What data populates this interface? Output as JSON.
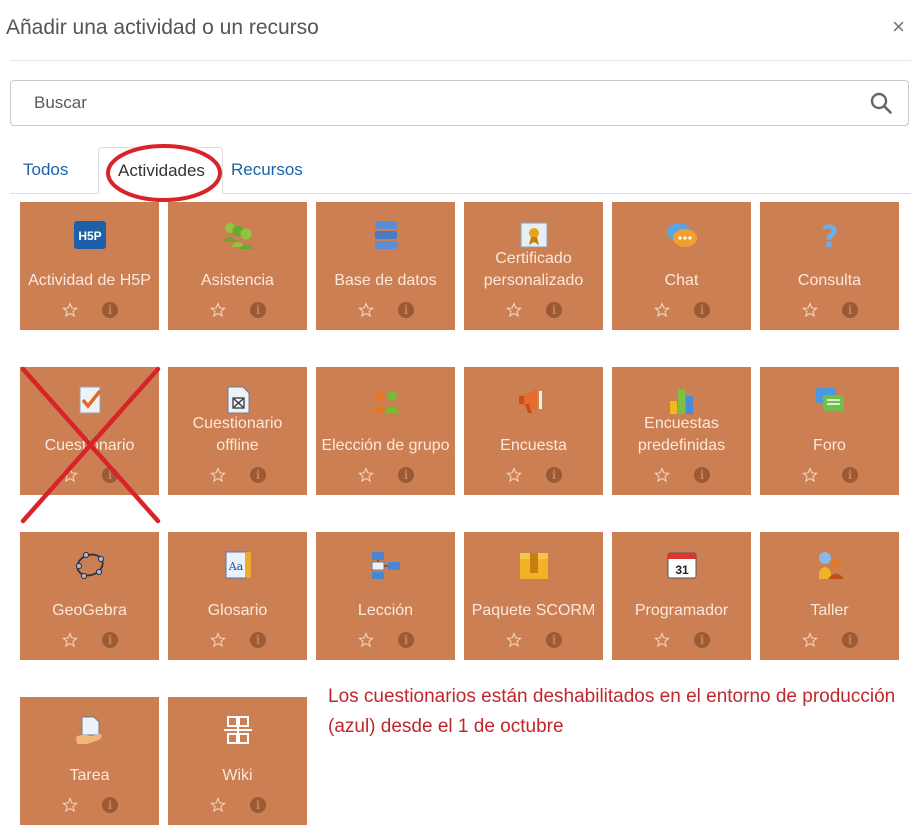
{
  "dialog": {
    "title": "Añadir una actividad o un recurso",
    "close_glyph": "×"
  },
  "search": {
    "placeholder": "Buscar",
    "value": "",
    "icon": "search-icon"
  },
  "tabs": [
    {
      "label": "Todos",
      "active": false
    },
    {
      "label": "Actividades",
      "active": true
    },
    {
      "label": "Recursos",
      "active": false
    }
  ],
  "items": [
    {
      "label": "Actividad de H5P",
      "icon": "h5p-icon"
    },
    {
      "label": "Asistencia",
      "icon": "attendance-icon"
    },
    {
      "label": "Base de datos",
      "icon": "database-icon"
    },
    {
      "label": "Certificado personalizado",
      "icon": "certificate-icon"
    },
    {
      "label": "Chat",
      "icon": "chat-icon"
    },
    {
      "label": "Consulta",
      "icon": "question-icon"
    },
    {
      "label": "Cuestionario",
      "icon": "quiz-icon"
    },
    {
      "label": "Cuestionario offline",
      "icon": "offline-quiz-icon"
    },
    {
      "label": "Elección de grupo",
      "icon": "group-choice-icon"
    },
    {
      "label": "Encuesta",
      "icon": "megaphone-icon"
    },
    {
      "label": "Encuestas predefinidas",
      "icon": "bar-chart-icon"
    },
    {
      "label": "Foro",
      "icon": "forum-icon"
    },
    {
      "label": "GeoGebra",
      "icon": "geogebra-icon"
    },
    {
      "label": "Glosario",
      "icon": "glossary-icon"
    },
    {
      "label": "Lección",
      "icon": "lesson-icon"
    },
    {
      "label": "Paquete SCORM",
      "icon": "package-icon"
    },
    {
      "label": "Programador",
      "icon": "calendar-icon"
    },
    {
      "label": "Taller",
      "icon": "workshop-icon"
    },
    {
      "label": "Tarea",
      "icon": "assignment-icon"
    },
    {
      "label": "Wiki",
      "icon": "wiki-icon"
    }
  ],
  "calendar_day": "31",
  "glossary_text": "Aa",
  "h5p_text": "H5P",
  "note": "Los cuestionarios están deshabilitados en el entorno de producción (azul) desde el 1 de octubre",
  "colors": {
    "card": "#cc7f52",
    "annotation": "#d8232a",
    "tab_link": "#1a63a8"
  }
}
